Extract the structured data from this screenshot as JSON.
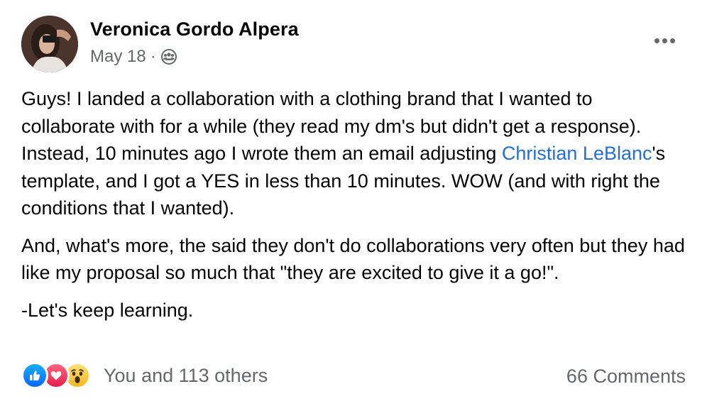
{
  "post": {
    "author": "Veronica Gordo Alpera",
    "date": "May 18",
    "separator": "·",
    "audience_icon": "group-icon",
    "more_icon": "more-options-icon",
    "body": {
      "p1_before": "Guys! I landed a collaboration with a clothing brand that I wanted to collaborate with for a while (they read my dm's but didn't get a response). Instead, 10 minutes ago I wrote them an email adjusting ",
      "p1_mention": "Christian LeBlanc",
      "p1_after": "'s template, and I got a YES in less than 10 minutes. WOW (and with right the conditions that I wanted).",
      "p2": "And, what's more, the said they don't do collaborations very often but they had like my proposal so much that \"they are excited to give it a go!\".",
      "p3": "-Let's keep learning."
    },
    "reactions": {
      "icons": [
        "like-icon",
        "love-icon",
        "wow-icon"
      ],
      "summary": "You and 113 others"
    },
    "comments": "66 Comments"
  },
  "colors": {
    "mention": "#216fdb",
    "secondary_text": "#65676b"
  }
}
